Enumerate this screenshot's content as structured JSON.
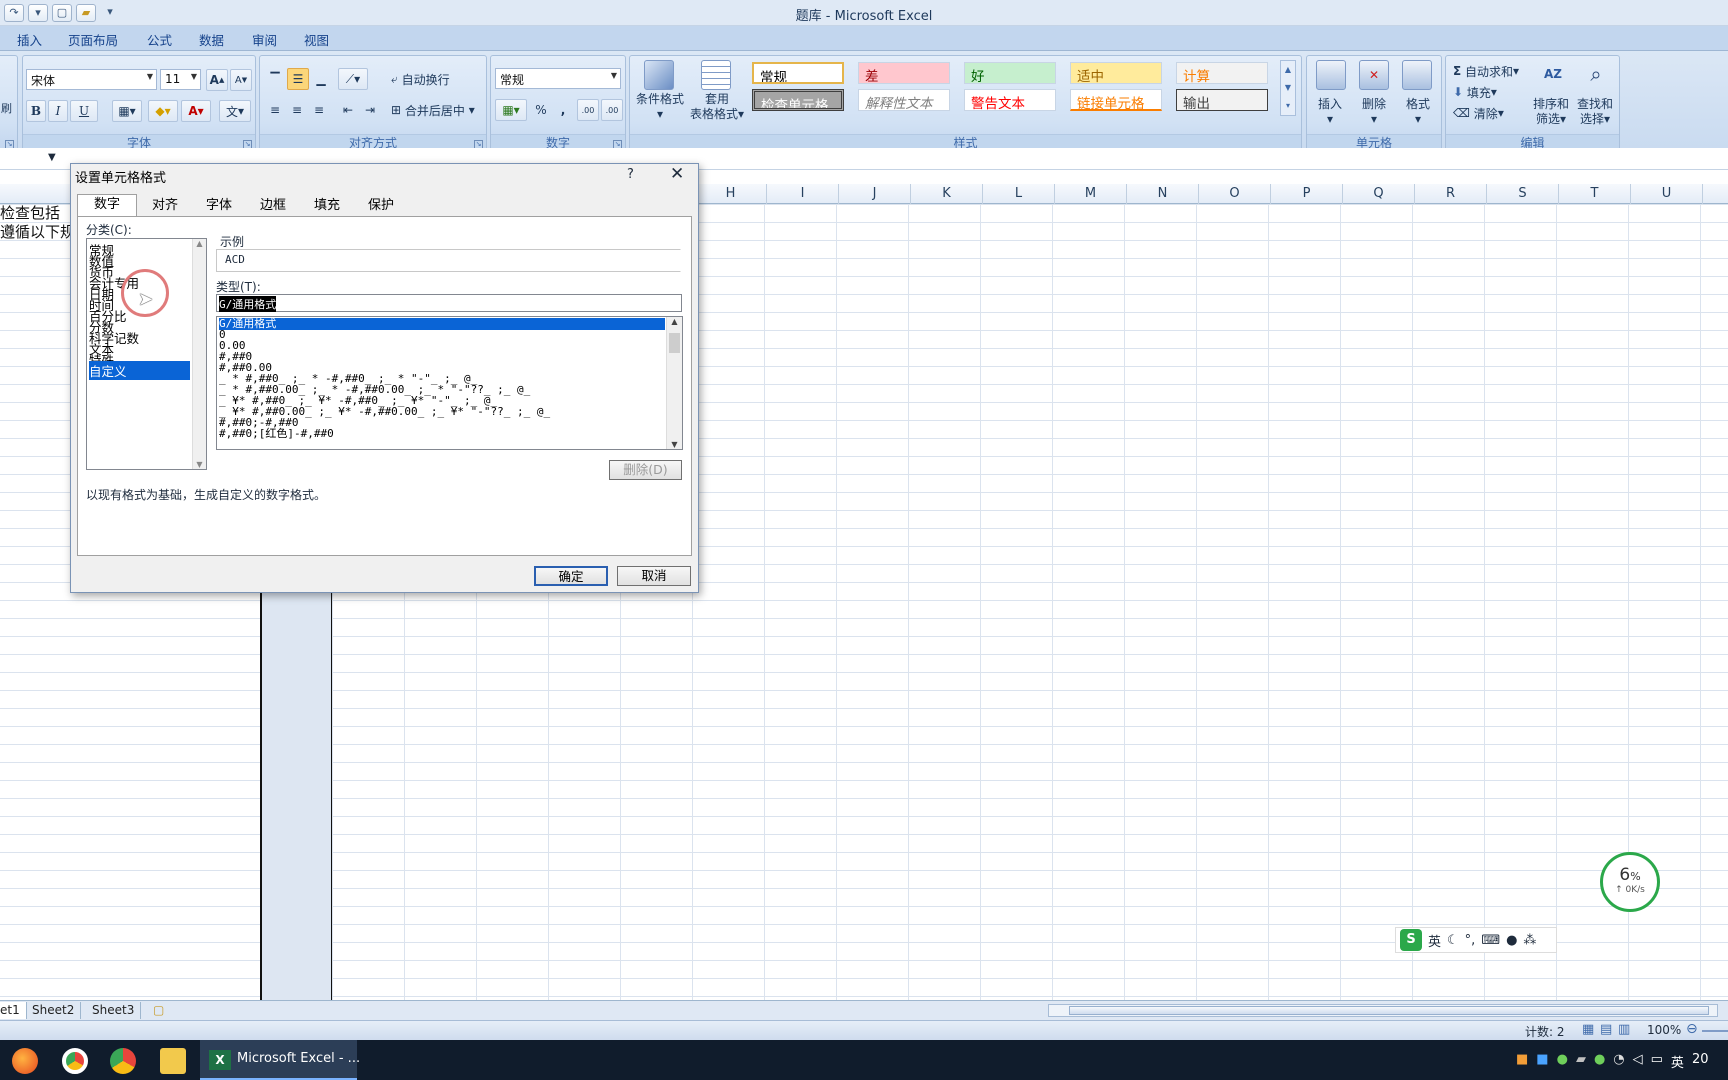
{
  "window": {
    "title": "题库 - Microsoft Excel"
  },
  "ribbon_tabs": [
    "插入",
    "页面布局",
    "公式",
    "数据",
    "审阅",
    "视图"
  ],
  "ribbon": {
    "font": {
      "name": "宋体",
      "size": "11",
      "group_label": "字体",
      "grow": "A",
      "shrink": "A",
      "bold": "B",
      "italic": "I",
      "underline": "U",
      "wen": "文"
    },
    "alignment": {
      "wrap_text": "自动换行",
      "merge_center": "合并后居中",
      "group_label": "对齐方式"
    },
    "number": {
      "format": "常规",
      "percent": "%",
      "comma": ",",
      "inc_dec": ".00",
      "dec_dec": ".00",
      "group_label": "数字"
    },
    "styles": {
      "conditional": "条件格式",
      "table_format_1": "套用",
      "table_format_2": "表格格式",
      "cells": [
        {
          "label": "常规",
          "bg": "#ffffff",
          "fg": "#000000"
        },
        {
          "label": "差",
          "bg": "#ffc7ce",
          "fg": "#9c0006"
        },
        {
          "label": "好",
          "bg": "#c6efce",
          "fg": "#006100"
        },
        {
          "label": "适中",
          "bg": "#ffeb9c",
          "fg": "#9c6500"
        },
        {
          "label": "计算",
          "bg": "#f2f2f2",
          "fg": "#fa7d00"
        },
        {
          "label": "检查单元格",
          "bg": "#a5a5a5",
          "fg": "#ffffff"
        },
        {
          "label": "解释性文本",
          "bg": "#ffffff",
          "fg": "#7f7f7f"
        },
        {
          "label": "警告文本",
          "bg": "#ffffff",
          "fg": "#ff0000"
        },
        {
          "label": "链接单元格",
          "bg": "#ffffff",
          "fg": "#fa7d00"
        },
        {
          "label": "输出",
          "bg": "#f2f2f2",
          "fg": "#3f3f3f"
        }
      ],
      "group_label": "样式"
    },
    "cells_group": {
      "insert": "插入",
      "delete": "删除",
      "format": "格式",
      "group_label": "单元格"
    },
    "editing": {
      "autosum": "自动求和",
      "fill": "填充",
      "clear": "清除",
      "sort_1": "排序和",
      "sort_2": "筛选",
      "find_1": "查找和",
      "find_2": "选择",
      "group_label": "编辑"
    }
  },
  "columns": [
    "H",
    "I",
    "J",
    "K",
    "L",
    "M",
    "N",
    "O",
    "P",
    "Q",
    "R",
    "S",
    "T",
    "U"
  ],
  "cells": {
    "text_1": "检查包括",
    "text_2": "遵循以下规"
  },
  "dialog": {
    "title": "设置单元格格式",
    "help": "?",
    "tabs": [
      "数字",
      "对齐",
      "字体",
      "边框",
      "填充",
      "保护"
    ],
    "category_label": "分类(C):",
    "categories": [
      "常规",
      "数值",
      "货币",
      "会计专用",
      "日期",
      "时间",
      "百分比",
      "分数",
      "科学记数",
      "文本",
      "特殊",
      "自定义"
    ],
    "selected_category": "自定义",
    "sample_label": "示例",
    "sample_value": "ACD",
    "type_label": "类型(T):",
    "type_value": "G/通用格式",
    "formats": [
      "G/通用格式",
      "0",
      "0.00",
      "#,##0",
      "#,##0.00",
      "_ * #,##0_ ;_ * -#,##0_ ;_ * \"-\"_ ;_ @_",
      "_ * #,##0.00_ ;_ * -#,##0.00_ ;_ * \"-\"??_ ;_ @_",
      "_ ¥* #,##0_ ;_ ¥* -#,##0_ ;_ ¥* \"-\"_ ;_ @_",
      "_ ¥* #,##0.00_ ;_ ¥* -#,##0.00_ ;_ ¥* \"-\"??_ ;_ @_",
      "#,##0;-#,##0",
      "#,##0;[红色]-#,##0"
    ],
    "delete_button": "删除(D)",
    "description": "以现有格式为基础，生成自定义的数字格式。",
    "ok": "确定",
    "cancel": "取消"
  },
  "sheets": [
    "et1",
    "Sheet2",
    "Sheet3"
  ],
  "status": {
    "count": "计数: 2",
    "zoom": "100%"
  },
  "speed_widget": {
    "percent": "6",
    "unit": "%",
    "rate": "0K/s"
  },
  "ime": {
    "lang": "英"
  },
  "taskbar": {
    "excel_label": "Microsoft Excel - ...",
    "tray_lang": "英",
    "clock_fragment": "20"
  }
}
